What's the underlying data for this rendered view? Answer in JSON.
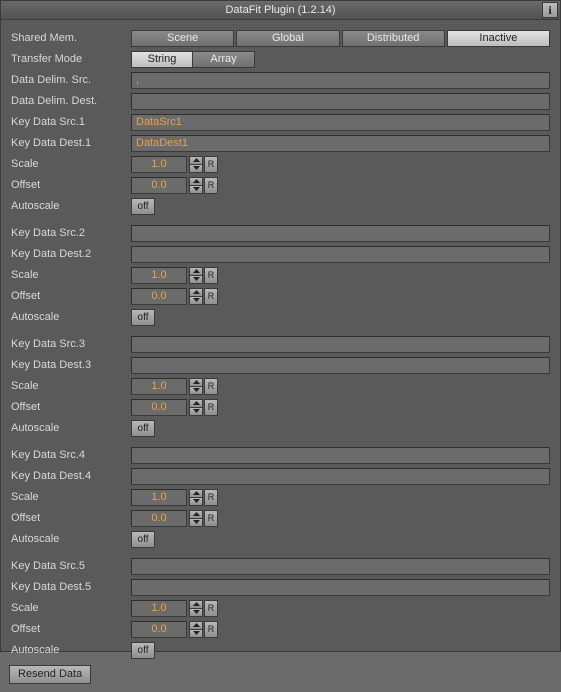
{
  "window": {
    "title": "DataFit Plugin (1.2.14)",
    "info": "i"
  },
  "shared_mem": {
    "label": "Shared Mem.",
    "tabs": [
      "Scene",
      "Global",
      "Distributed",
      "Inactive"
    ],
    "active_index": 3
  },
  "transfer_mode": {
    "label": "Transfer Mode",
    "options": [
      "String",
      "Array"
    ],
    "active_index": 0
  },
  "data_delim_src": {
    "label": "Data Delim. Src.",
    "value": ","
  },
  "data_delim_dest": {
    "label": "Data Delim. Dest.",
    "value": ""
  },
  "groups": [
    {
      "src_label": "Key Data Src.1",
      "dest_label": "Key Data Dest.1",
      "src": "DataSrc1",
      "dest": "DataDest1",
      "scale_label": "Scale",
      "scale": "1.0",
      "offset_label": "Offset",
      "offset": "0.0",
      "autoscale_label": "Autoscale",
      "autoscale": "off"
    },
    {
      "src_label": "Key Data Src.2",
      "dest_label": "Key Data Dest.2",
      "src": "",
      "dest": "",
      "scale_label": "Scale",
      "scale": "1.0",
      "offset_label": "Offset",
      "offset": "0.0",
      "autoscale_label": "Autoscale",
      "autoscale": "off"
    },
    {
      "src_label": "Key Data Src.3",
      "dest_label": "Key Data Dest.3",
      "src": "",
      "dest": "",
      "scale_label": "Scale",
      "scale": "1.0",
      "offset_label": "Offset",
      "offset": "0.0",
      "autoscale_label": "Autoscale",
      "autoscale": "off"
    },
    {
      "src_label": "Key Data Src.4",
      "dest_label": "Key Data Dest.4",
      "src": "",
      "dest": "",
      "scale_label": "Scale",
      "scale": "1.0",
      "offset_label": "Offset",
      "offset": "0.0",
      "autoscale_label": "Autoscale",
      "autoscale": "off"
    },
    {
      "src_label": "Key Data Src.5",
      "dest_label": "Key Data Dest.5",
      "src": "",
      "dest": "",
      "scale_label": "Scale",
      "scale": "1.0",
      "offset_label": "Offset",
      "offset": "0.0",
      "autoscale_label": "Autoscale",
      "autoscale": "off"
    }
  ],
  "reset_btn": "R",
  "resend": "Resend Data"
}
